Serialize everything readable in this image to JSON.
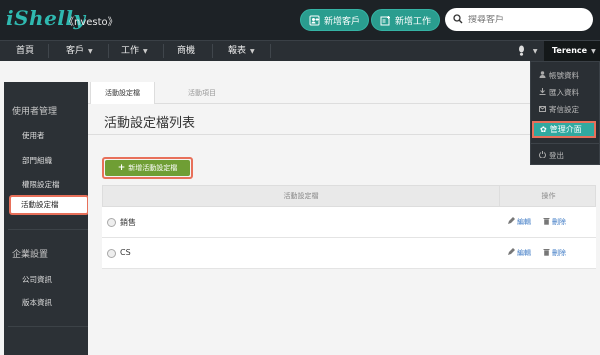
{
  "header": {
    "logo": "iShelly",
    "company": "《nvesto》",
    "buttons": [
      {
        "label": "新增客戶",
        "icon": "add-contact-icon"
      },
      {
        "label": "新增工作",
        "icon": "add-task-icon"
      }
    ],
    "search": {
      "placeholder": "搜尋客戶"
    }
  },
  "nav": {
    "items": [
      "首頁",
      "客戶",
      "工作",
      "商機",
      "報表"
    ],
    "user": "Terence"
  },
  "user_menu": {
    "items": [
      "帳號資料",
      "匯入資料",
      "寄信設定",
      "管理介面",
      "登出"
    ],
    "active": "管理介面"
  },
  "sidebar": {
    "sections": [
      {
        "title": "使用者管理",
        "items": [
          "使用者",
          "部門組織",
          "權限設定檔",
          "活動設定檔"
        ]
      },
      {
        "title": "企業設置",
        "items": [
          "公司資訊",
          "版本資訊"
        ]
      }
    ],
    "active": "活動設定檔"
  },
  "main": {
    "tabs": [
      "活動設定檔",
      "活動項目"
    ],
    "title": "活動設定檔列表",
    "add_button": "新增活動設定檔",
    "table": {
      "headers": [
        "活動設定檔",
        "操作"
      ],
      "rows": [
        {
          "name": "銷售",
          "edit": "編輯",
          "delete": "刪除"
        },
        {
          "name": "CS",
          "edit": "編輯",
          "delete": "刪除"
        }
      ]
    }
  },
  "colors": {
    "accent": "#2a9d8f",
    "highlight": "#e8705a",
    "add_button": "#6f9e34",
    "link": "#3b78c4"
  }
}
